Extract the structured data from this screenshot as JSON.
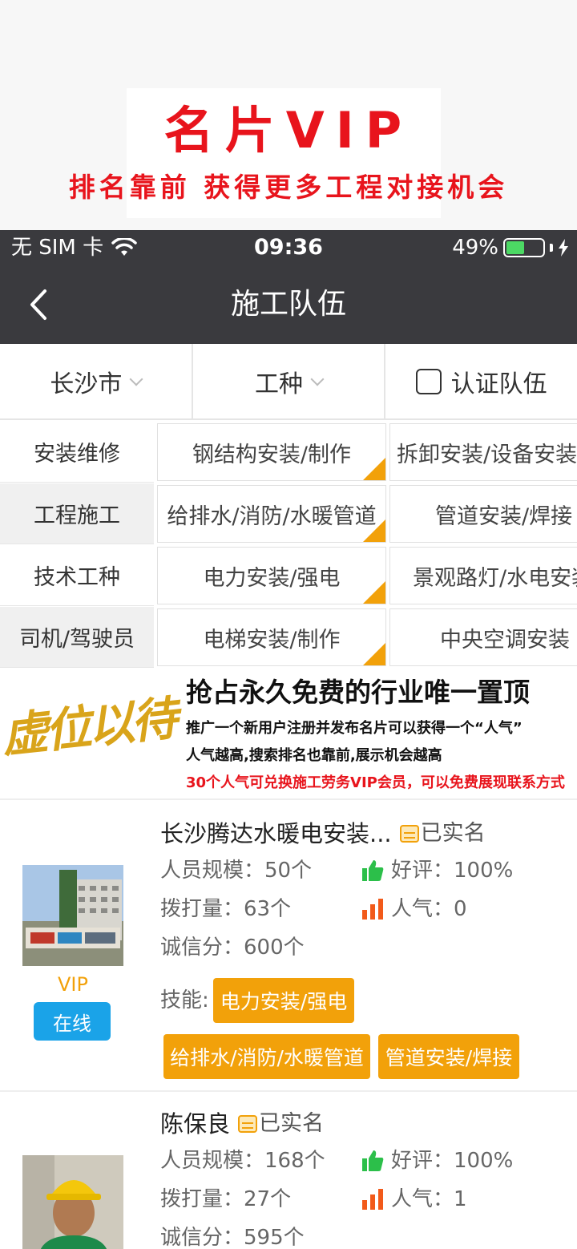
{
  "promo": {
    "title": "名片VIP",
    "subtitle": "排名靠前 获得更多工程对接机会"
  },
  "status_bar": {
    "carrier": "无 SIM 卡",
    "time": "09:36",
    "battery": "49%",
    "battery_level": 0.49
  },
  "nav": {
    "title": "施工队伍"
  },
  "filters": {
    "city": "长沙市",
    "trade": "工种",
    "certified": "认证队伍"
  },
  "categories": [
    {
      "name": "安装维修",
      "chips": [
        "钢结构安装/制作",
        "拆卸安装/设备安装"
      ]
    },
    {
      "name": "工程施工",
      "chips": [
        "给排水/消防/水暖管道",
        "管道安装/焊接"
      ]
    },
    {
      "name": "技术工种",
      "chips": [
        "电力安装/强电",
        "景观路灯/水电安装"
      ]
    },
    {
      "name": "司机/驾驶员",
      "chips": [
        "电梯安装/制作",
        "中央空调安装"
      ]
    }
  ],
  "banner": {
    "stamp": "虚位以待",
    "headline": "抢占永久免费的行业唯一置顶",
    "line1": "推广一个新用户注册并发布名片可以获得一个“人气”",
    "line2": "人气越高,搜索排名也靠前,展示机会越高",
    "line3": "30个人气可兑换施工劳务VIP会员，可以免费展现联系方式"
  },
  "listings": [
    {
      "name": "长沙腾达水暖电安装...",
      "verified": "已实名",
      "team_size": "人员规模：50个",
      "rating": "好评：100%",
      "calls": "拨打量：63个",
      "popularity": "人气：0",
      "credit": "诚信分：600个",
      "vip": "VIP",
      "online": "在线",
      "skills_label": "技能:",
      "skills": [
        "电力安装/强电",
        "给排水/消防/水暖管道",
        "管道安装/焊接"
      ]
    },
    {
      "name": "陈保良",
      "verified": "已实名",
      "team_size": "人员规模：168个",
      "rating": "好评：100%",
      "calls": "拨打量：27个",
      "popularity": "人气：1",
      "credit": "诚信分：595个"
    }
  ],
  "colors": {
    "accent_red": "#e8141c",
    "dark_bar": "#3a3a3e",
    "orange": "#f2a10a",
    "online_blue": "#1aa3e8",
    "like_green": "#2cbf4a",
    "signal_orange": "#f25a1a"
  },
  "icons": {
    "wifi": "wifi-icon",
    "back": "chevron-left-icon",
    "thumbs_up": "thumbs-up-icon",
    "popularity": "signal-bars-icon",
    "verified": "id-card-icon"
  }
}
